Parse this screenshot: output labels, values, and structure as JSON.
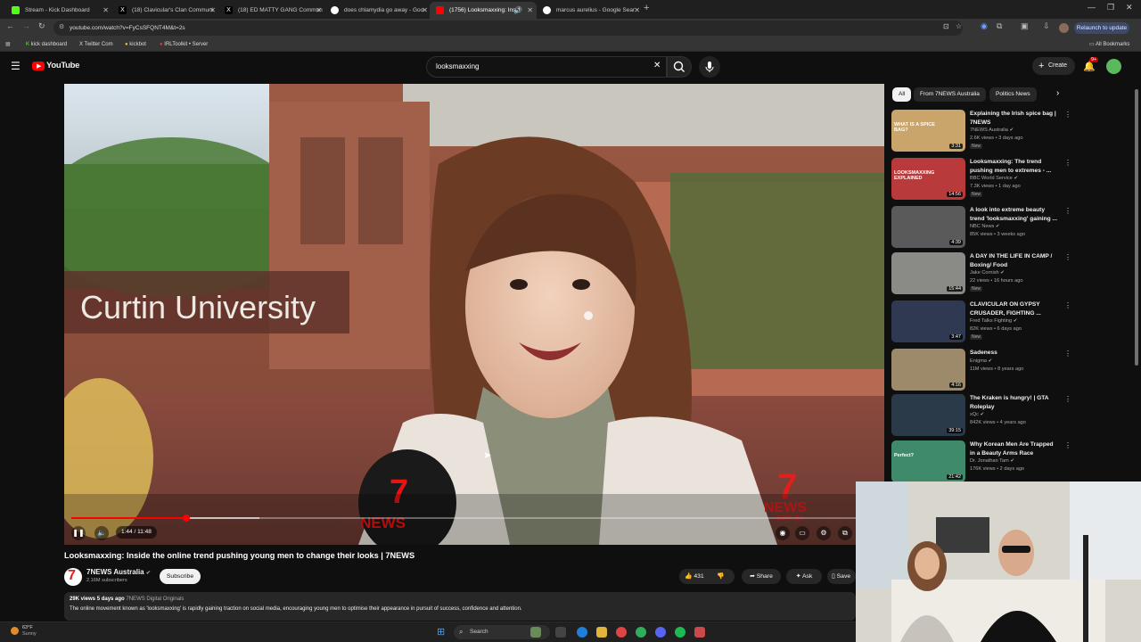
{
  "browser": {
    "tabs": [
      {
        "title": "Stream - Kick Dashboard",
        "active": false
      },
      {
        "title": "(18) Clavicular's Clan Communi",
        "active": false
      },
      {
        "title": "(18) ED MATTY GANG Commun",
        "active": false
      },
      {
        "title": "does chlamydia go away - Goo",
        "active": false
      },
      {
        "title": "(1756) Looksmaxxing: Insid",
        "active": true
      },
      {
        "title": "marcus aurelius - Google Sear",
        "active": false
      }
    ],
    "url": "youtube.com/watch?v=FyCsSFQNT4M&t=2s",
    "relaunch_label": "Relaunch to update",
    "bookmarks": [
      {
        "label": "kick dashboard"
      },
      {
        "label": "Twitter Com"
      },
      {
        "label": "kickbot"
      },
      {
        "label": "IRLToolkit • Server"
      }
    ],
    "all_bookmarks_label": "All Bookmarks"
  },
  "youtube": {
    "logo_text": "YouTube",
    "search_value": "looksmaxxing",
    "create_label": "Create",
    "notif_badge": "9+"
  },
  "player": {
    "overlay_text": "Curtin University",
    "logo_7": "7",
    "logo_news": "NEWS",
    "logo_domain": ".com.au",
    "mic_7": "7",
    "mic_news": "NEWS",
    "current_time": "1:44",
    "duration": "11:48",
    "time_label": "1:44 / 11:48",
    "progress_fraction": 0.147,
    "buffered_fraction": 0.24
  },
  "video": {
    "title": "Looksmaxxing: Inside the online trend pushing young men to change their looks | 7NEWS",
    "channel": "7NEWS Australia",
    "subscribers": "2.16M subscribers",
    "subscribe_label": "Subscribe",
    "likes": "431",
    "share_label": "Share",
    "ask_label": "Ask",
    "save_label": "Save",
    "views": "29K views",
    "age": "5 days ago",
    "tagline": "7NEWS Digital Originals",
    "description": "The online movement known as 'looksmaxxing' is rapidly gaining traction on social media, encouraging young men to optimise their appearance in pursuit of success, confidence and attention."
  },
  "chips": [
    {
      "label": "All",
      "selected": true
    },
    {
      "label": "From 7NEWS Australia",
      "selected": false
    },
    {
      "label": "Politics News",
      "selected": false
    }
  ],
  "recommendations": [
    {
      "title": "Explaining the Irish spice bag | 7NEWS",
      "channel": "7NEWS Australia",
      "meta": "2.6K views • 3 days ago",
      "badge": "New",
      "duration": "3:31",
      "thumb_color": "#c9a46b",
      "thumb_text": "WHAT IS A SPICE BAG?"
    },
    {
      "title": "Looksmaxxing: The trend pushing men to extremes - ...",
      "channel": "BBC World Service",
      "meta": "7.3K views • 1 day ago",
      "badge": "New",
      "duration": "14:56",
      "thumb_color": "#b83a3a",
      "thumb_text": "LOOKSMAXXING EXPLAINED"
    },
    {
      "title": "A look into extreme beauty trend 'looksmaxxing' gaining ...",
      "channel": "NBC News",
      "meta": "85K views • 3 weeks ago",
      "badge": "",
      "duration": "4:39",
      "thumb_color": "#5a5a5a",
      "thumb_text": ""
    },
    {
      "title": "A DAY IN THE LIFE IN CAMP / Boxing/ Food",
      "channel": "Jake Cornish",
      "meta": "22 views • 16 hours ago",
      "badge": "New",
      "duration": "15:44",
      "thumb_color": "#8a8a86",
      "thumb_text": ""
    },
    {
      "title": "CLAVICULAR ON GYPSY CRUSADER, FIGHTING ...",
      "channel": "Fred Talks Fighting",
      "meta": "82K views • 6 days ago",
      "badge": "New",
      "duration": "3:47",
      "thumb_color": "#2f3a52",
      "thumb_text": ""
    },
    {
      "title": "Sadeness",
      "channel": "Enigma",
      "meta": "11M views • 8 years ago",
      "badge": "",
      "duration": "4:16",
      "thumb_color": "#9c8a6a",
      "thumb_text": ""
    },
    {
      "title": "The Kraken is hungry! | GTA Roleplay",
      "channel": "xQc",
      "meta": "842K views • 4 years ago",
      "badge": "",
      "duration": "39:15",
      "thumb_color": "#2a3a48",
      "thumb_text": ""
    },
    {
      "title": "Why Korean Men Are Trapped in a Beauty Arms Race",
      "channel": "Dr. Jonathan Tam",
      "meta": "176K views • 2 days ago",
      "badge": "",
      "duration": "21:42",
      "thumb_color": "#3f8a6a",
      "thumb_text": "Perfect?"
    }
  ],
  "taskbar": {
    "temperature": "63°F",
    "weather": "Sunny",
    "search_placeholder": "Search"
  },
  "colors": {
    "accent_red": "#ff0000",
    "bg": "#0f0f0f",
    "chip_bg": "#272727"
  }
}
